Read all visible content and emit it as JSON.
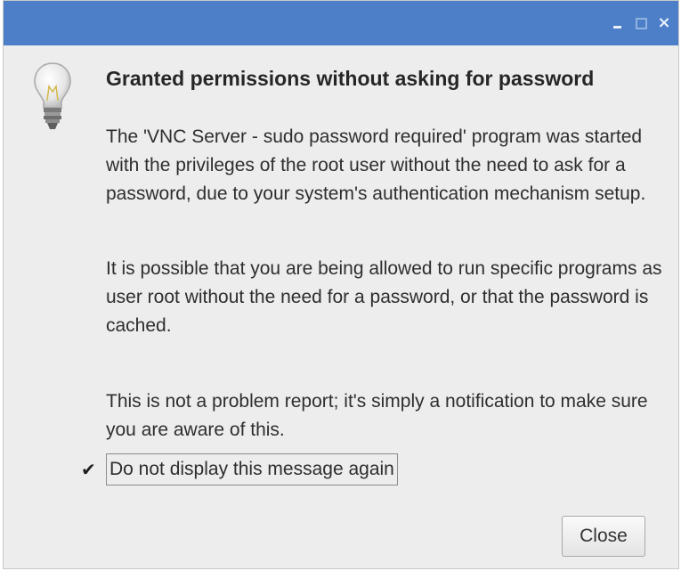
{
  "window": {
    "titlebar_color": "#4d7fc8",
    "controls": {
      "minimize_icon": "minimize-icon",
      "maximize_icon": "maximize-icon",
      "close_label": "×"
    }
  },
  "dialog": {
    "icon": "lightbulb-icon",
    "heading": "Granted permissions without asking for password",
    "paragraphs": [
      "The 'VNC Server - sudo password required' program was started with the privileges of the root user without the need to ask for a password, due to your system's authentication mechanism setup.",
      "It is possible that you are being allowed to run specific programs as user root without the need for a password, or that the password is cached.",
      "This is not a problem report; it's simply a notification to make sure you are aware of this."
    ],
    "checkbox": {
      "checked": true,
      "mark": "✔",
      "label": "Do not display this message again"
    },
    "close_button_label": "Close"
  }
}
